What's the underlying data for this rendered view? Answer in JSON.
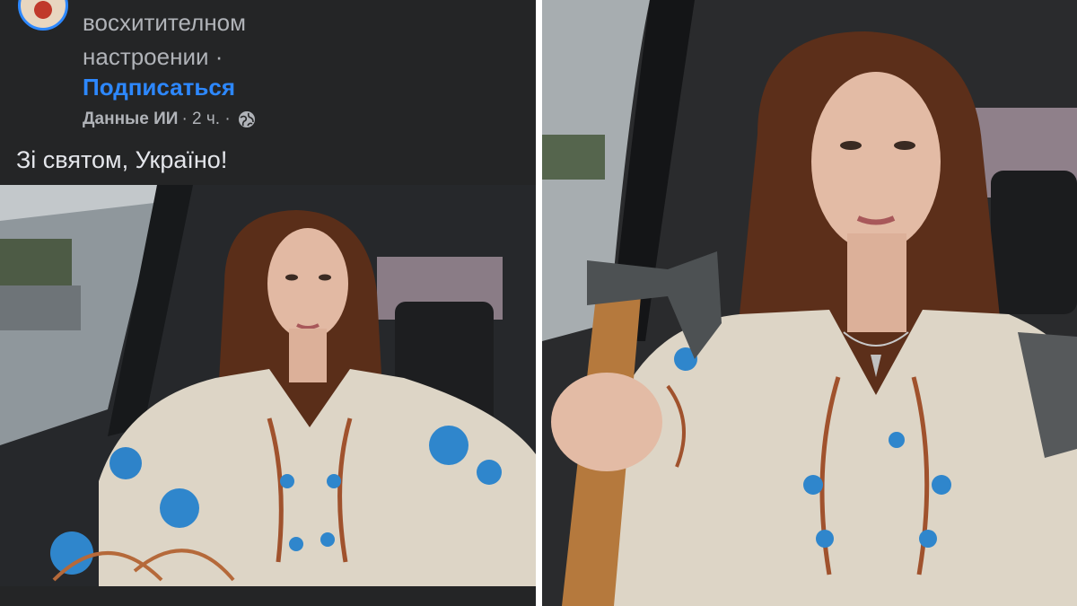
{
  "post": {
    "header_line_1": "восхитителном",
    "header_line_2": "настроении ·",
    "follow_label": "Подписаться",
    "author": "Данные ИИ",
    "time": "· 2 ч. ·",
    "privacy_icon": "globe-icon",
    "text": "Зі святом, Україно!"
  },
  "colors": {
    "background": "#242526",
    "link": "#2d88ff",
    "secondary_text": "#b0b3b8",
    "primary_text": "#e4e6eb"
  }
}
